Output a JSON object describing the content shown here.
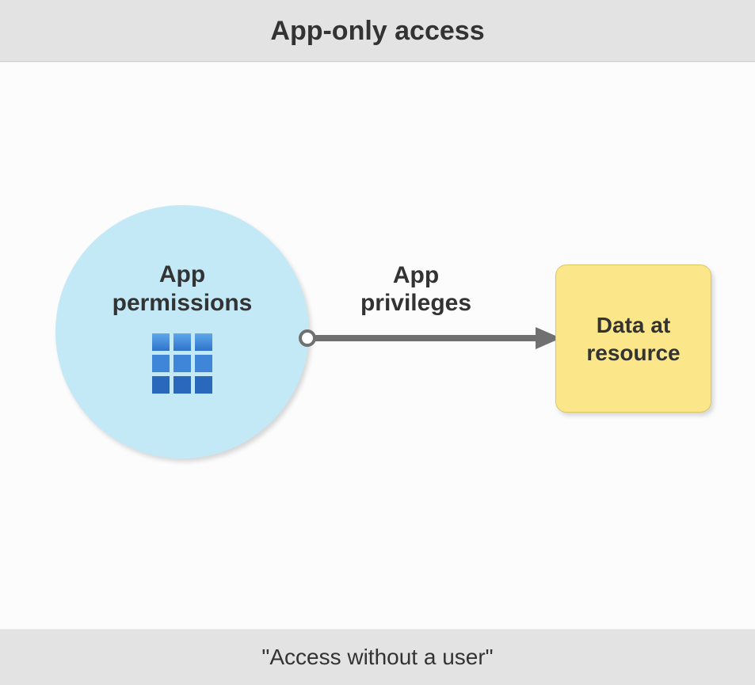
{
  "header": {
    "title": "App-only access"
  },
  "nodes": {
    "app": {
      "label_line1": "App",
      "label_line2": "permissions",
      "icon": "app-grid-icon"
    },
    "resource": {
      "label_line1": "Data at",
      "label_line2": "resource"
    }
  },
  "edge": {
    "label_line1": "App",
    "label_line2": "privileges"
  },
  "footer": {
    "caption": "\"Access without a user\""
  },
  "colors": {
    "circle_fill": "#c3e9f7",
    "box_fill": "#fbe789",
    "arrow": "#707070",
    "icon_blue_a": "#4f9de8",
    "icon_blue_b": "#2f73c9"
  }
}
